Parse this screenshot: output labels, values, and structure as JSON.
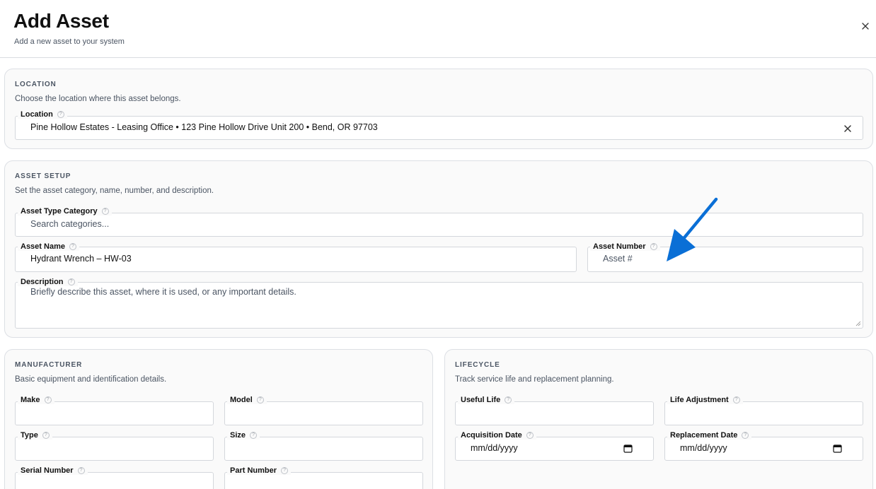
{
  "header": {
    "title": "Add Asset",
    "subtitle": "Add a new asset to your system"
  },
  "location_section": {
    "title": "LOCATION",
    "description": "Choose the location where this asset belongs.",
    "location_field": {
      "label": "Location",
      "value": "Pine Hollow Estates - Leasing Office • 123 Pine Hollow Drive Unit 200 • Bend, OR 97703"
    }
  },
  "asset_setup_section": {
    "title": "ASSET SETUP",
    "description": "Set the asset category, name, number, and description.",
    "category_field": {
      "label": "Asset Type Category",
      "placeholder": "Search categories..."
    },
    "name_field": {
      "label": "Asset Name",
      "value": "Hydrant Wrench – HW-03"
    },
    "number_field": {
      "label": "Asset Number",
      "placeholder": "Asset #"
    },
    "description_field": {
      "label": "Description",
      "placeholder": "Briefly describe this asset, where it is used, or any important details."
    }
  },
  "manufacturer_section": {
    "title": "MANUFACTURER",
    "description": "Basic equipment and identification details.",
    "fields": {
      "make": {
        "label": "Make",
        "value": ""
      },
      "model": {
        "label": "Model",
        "value": ""
      },
      "type": {
        "label": "Type",
        "value": ""
      },
      "size": {
        "label": "Size",
        "value": ""
      },
      "serial_number": {
        "label": "Serial Number",
        "value": ""
      },
      "part_number": {
        "label": "Part Number",
        "value": ""
      }
    }
  },
  "lifecycle_section": {
    "title": "LIFECYCLE",
    "description": "Track service life and replacement planning.",
    "fields": {
      "useful_life": {
        "label": "Useful Life",
        "value": ""
      },
      "life_adjustment": {
        "label": "Life Adjustment",
        "value": ""
      },
      "acquisition_date": {
        "label": "Acquisition Date",
        "placeholder": "mm/dd/yyyy"
      },
      "replacement_date": {
        "label": "Replacement Date",
        "placeholder": "mm/dd/yyyy"
      }
    }
  },
  "help_glyph": "?",
  "icons": {
    "close": "close-icon",
    "clear": "clear-icon",
    "help": "help-circle-icon",
    "calendar": "calendar-icon",
    "annotation_arrow": "arrow-annotation-icon"
  },
  "colors": {
    "annotation_arrow": "#0a6fd6"
  }
}
